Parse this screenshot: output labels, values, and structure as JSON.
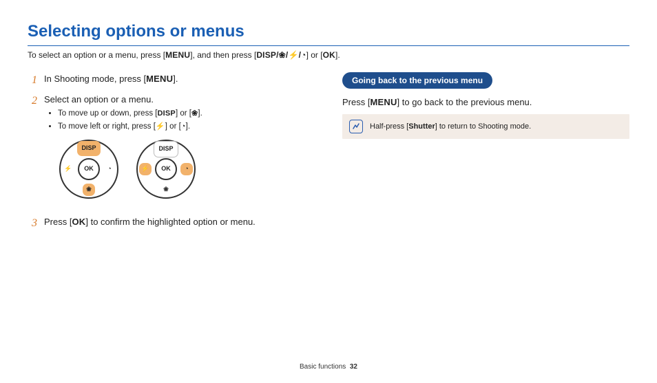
{
  "title": "Selecting options or menus",
  "intro_prefix": "To select an option or a menu, press [",
  "intro_mid1": "], and then press [",
  "intro_mid2": "] or [",
  "intro_suffix": "].",
  "labels": {
    "menu": "MENU",
    "disp": "DISP",
    "ok": "OK",
    "shutter": "Shutter",
    "macro": "❀",
    "flash": "⚡",
    "timer": "◔",
    "dirs": "DISP/❀/⚡/◔"
  },
  "steps": {
    "s1_num": "1",
    "s1_a": "In Shooting mode, press [",
    "s1_b": "].",
    "s2_num": "2",
    "s2_a": "Select an option or a menu.",
    "s2_b1_a": "To move up or down, press [",
    "s2_b1_b": "] or [",
    "s2_b1_c": "].",
    "s2_b2_a": "To move left or right, press [",
    "s2_b2_b": "] or [",
    "s2_b2_c": "].",
    "s3_num": "3",
    "s3_a": "Press [",
    "s3_b": "] to confirm the highlighted option or menu."
  },
  "right": {
    "pill": "Going back to the previous menu",
    "line_a": "Press [",
    "line_b": "] to go back to the previous menu.",
    "note_a": "Half-press [",
    "note_b": "] to return to Shooting mode."
  },
  "dpad": {
    "ok": "OK",
    "disp": "DISP"
  },
  "footer": {
    "section": "Basic functions",
    "page": "32"
  }
}
